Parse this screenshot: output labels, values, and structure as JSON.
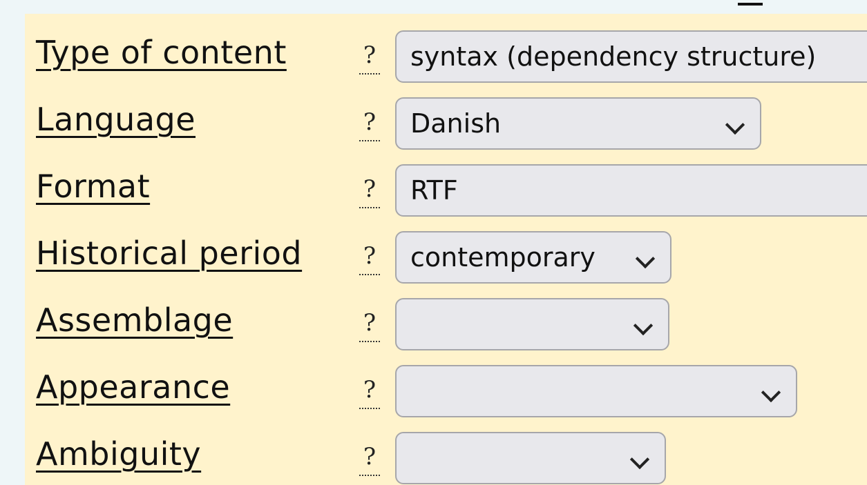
{
  "form": {
    "rows": [
      {
        "label": "Type of content",
        "help": "?",
        "value": "syntax (dependency structure)"
      },
      {
        "label": "Language",
        "help": "?",
        "value": "Danish"
      },
      {
        "label": "Format",
        "help": "?",
        "value": "RTF"
      },
      {
        "label": "Historical period",
        "help": "?",
        "value": "contemporary"
      },
      {
        "label": "Assemblage",
        "help": "?",
        "value": ""
      },
      {
        "label": "Appearance",
        "help": "?",
        "value": ""
      },
      {
        "label": "Ambiguity",
        "help": "?",
        "value": ""
      }
    ]
  },
  "colors": {
    "panel_background": "#fff3cc",
    "page_background": "#eef6f8",
    "select_background": "#e8e8ec",
    "select_border": "#a6a6aa"
  },
  "icons": {
    "help": "question-mark-icon",
    "dropdown": "chevron-down-icon"
  }
}
